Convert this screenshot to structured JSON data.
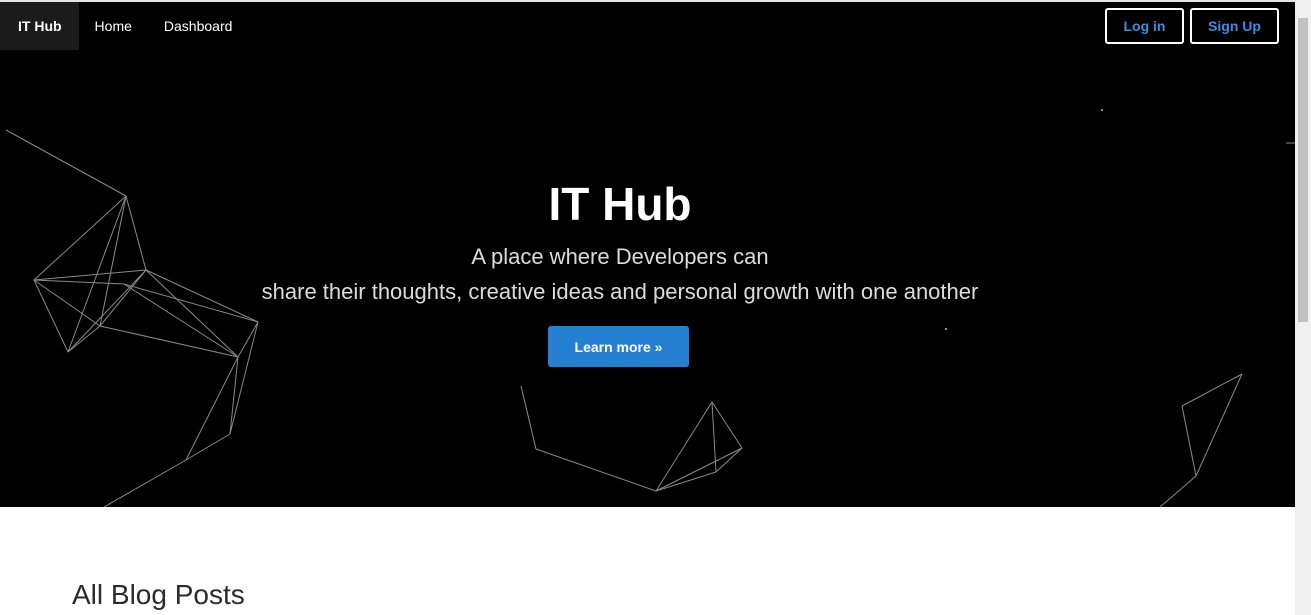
{
  "nav": {
    "brand": "IT Hub",
    "links": [
      "Home",
      "Dashboard"
    ],
    "login_label": "Log in",
    "signup_label": "Sign Up"
  },
  "hero": {
    "title": "IT Hub",
    "subtitle_line1": "A place where Developers can",
    "subtitle_line2": "share their thoughts, creative ideas and personal growth with one another",
    "cta_label": "Learn more »"
  },
  "main": {
    "section_title": "All Blog Posts"
  },
  "colors": {
    "hero_background": "#000000",
    "accent": "#2680d2",
    "nav_button_text": "#3b8de0"
  }
}
